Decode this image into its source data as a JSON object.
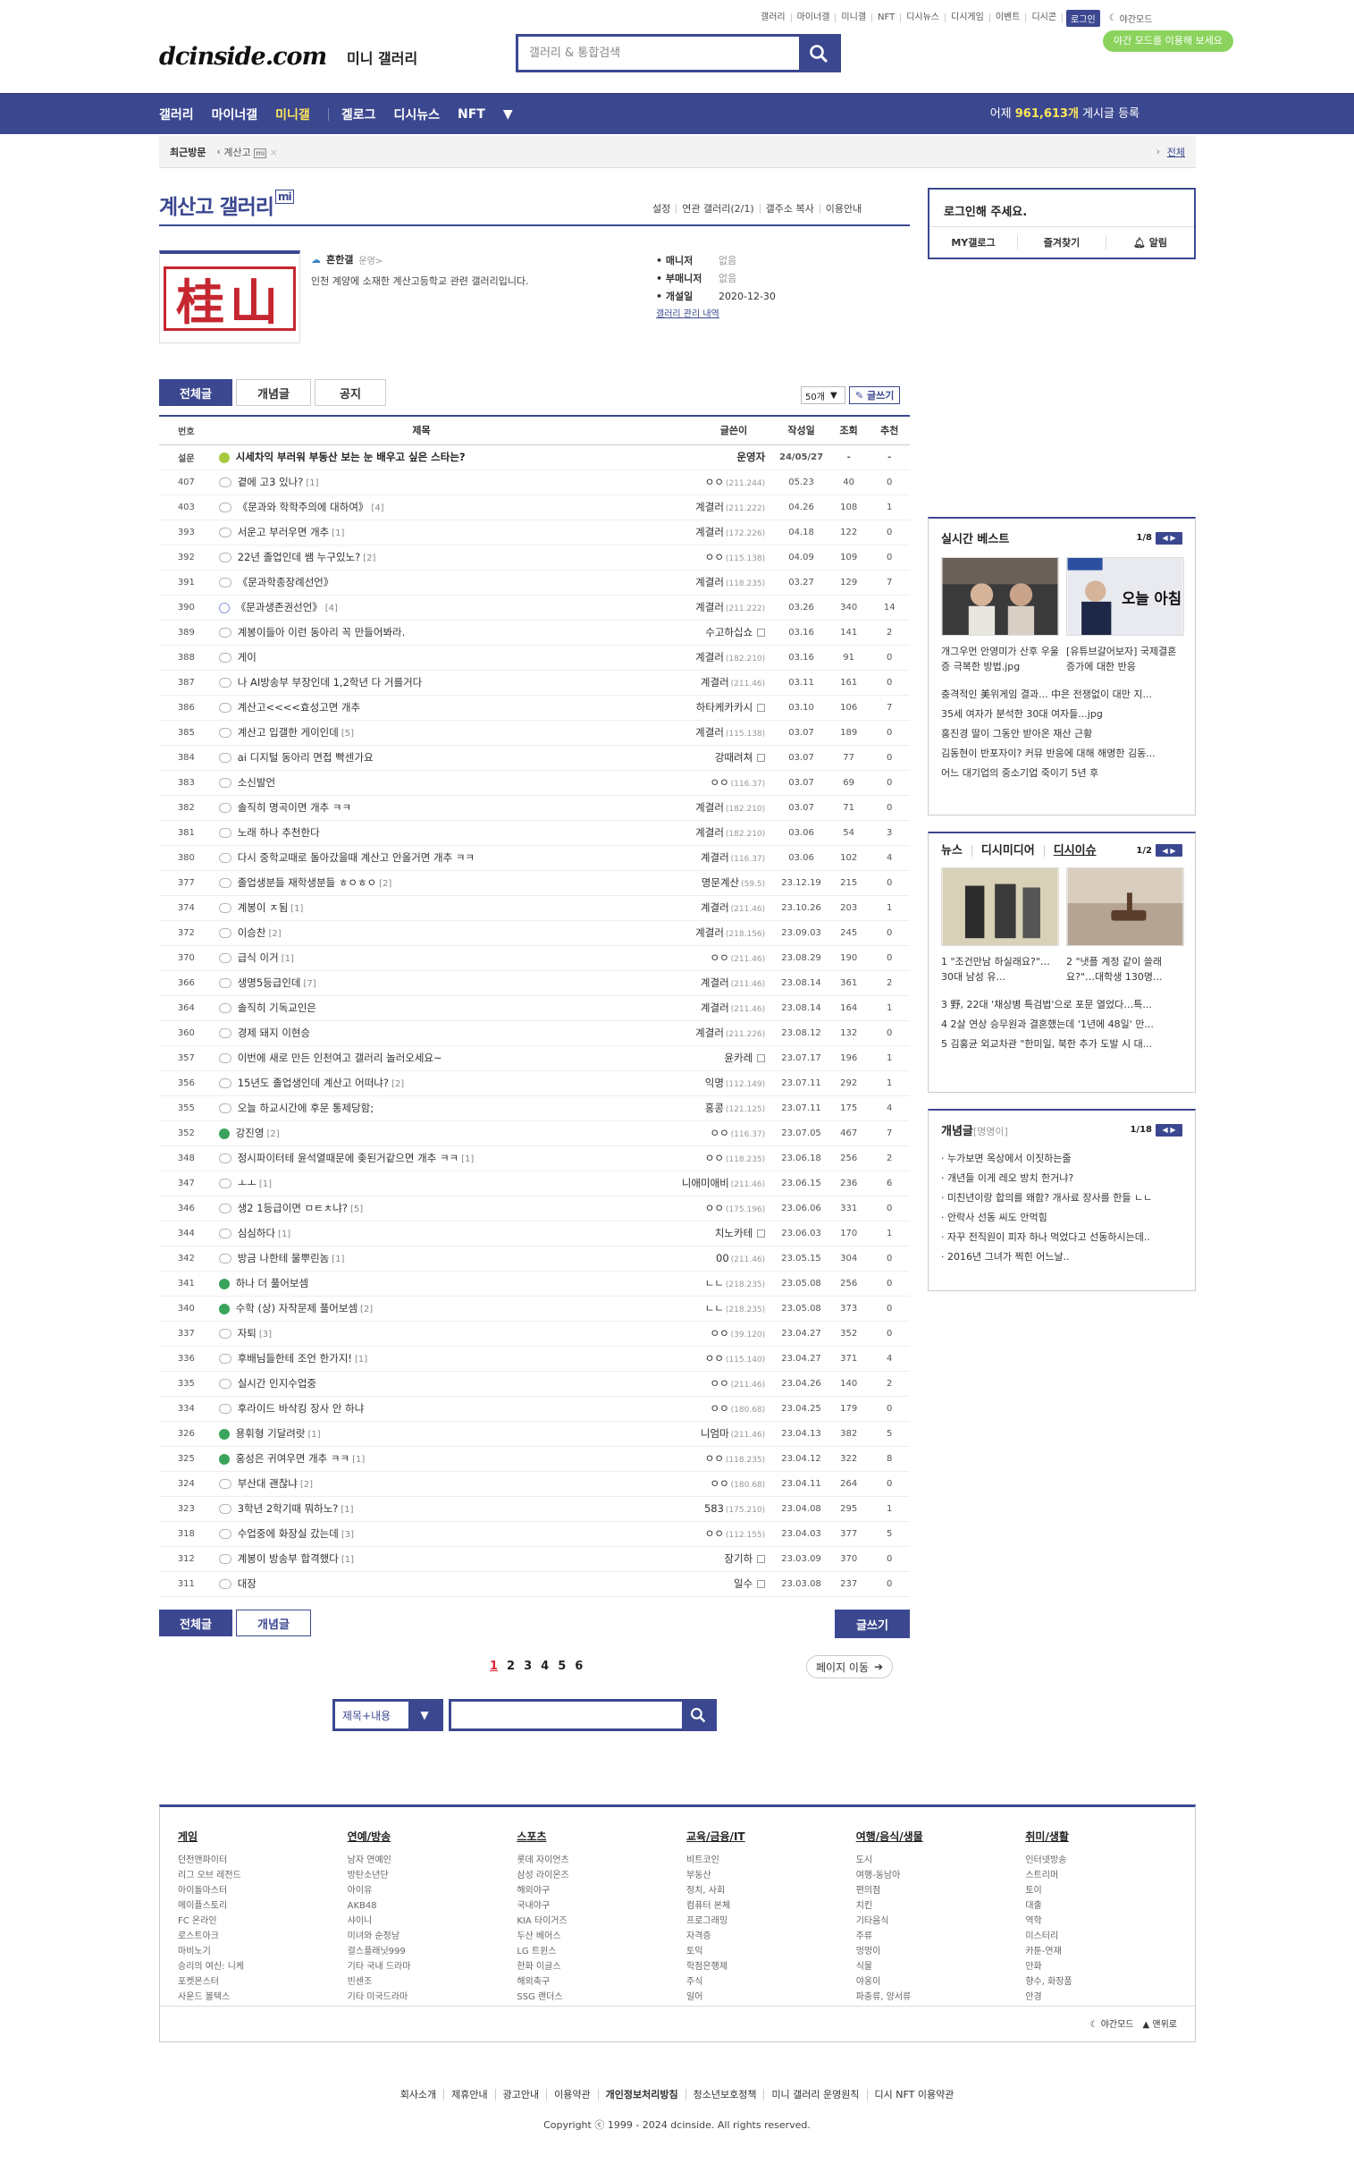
{
  "top": {
    "links": [
      "갤러리",
      "마이너갤",
      "미니갤",
      "NFT",
      "디시뉴스",
      "디시게임",
      "이벤트",
      "디시콘"
    ],
    "login": "로그인",
    "night": "야간모드",
    "night_tip": "야간 모드를 이용해 보세요"
  },
  "logo": {
    "text": "dcinside.com",
    "sub": "미니 갤러리"
  },
  "search": {
    "placeholder": "갤러리 & 통합검색"
  },
  "nav": {
    "items": [
      "갤러리",
      "마이너갤",
      "미니갤",
      "겔로그",
      "디시뉴스",
      "NFT"
    ],
    "count_prefix": "어제",
    "count_value": "961,613개",
    "count_suffix": "게시글 등록"
  },
  "recent": {
    "label": "최근방문",
    "item": "계산고",
    "all": "전체"
  },
  "gallery": {
    "title": "계산고 갤러리",
    "badge": "mi",
    "links": [
      "설정",
      "연관 갤러리(2/1)",
      "갤주소 복사",
      "이용안내"
    ],
    "manager": "흔한갤",
    "manager_sub": "운영>",
    "desc": "인천 계양에 소재한 계산고등학교 관련 갤러리입니다.",
    "image_text": "桂山",
    "meta": [
      {
        "k": "매니저",
        "v": "없음"
      },
      {
        "k": "부매니저",
        "v": "없음"
      },
      {
        "k": "개설일",
        "v": "2020-12-30"
      }
    ],
    "history": "갤러리 관리 내역"
  },
  "tabs": [
    "전체글",
    "개념글",
    "공지"
  ],
  "list_tools": {
    "count": "50개",
    "write": "글쓰기"
  },
  "table": {
    "headers": [
      "번호",
      "제목",
      "글쓴이",
      "작성일",
      "조회",
      "추천"
    ],
    "notice": {
      "num": "설문",
      "title": "시세차익 부러워 부동산 보는 눈 배우고 싶은 스타는?",
      "writer": "운영자",
      "date": "24/05/27",
      "views": "-",
      "rec": "-"
    },
    "rows": [
      {
        "num": "407",
        "title": "곁에 고3 있나?",
        "cmt": "[1]",
        "writer": "ㅇㅇ",
        "ip": "(211.244)",
        "date": "05.23",
        "views": "40",
        "rec": "0",
        "icon": "txt"
      },
      {
        "num": "403",
        "title": "《문과와 학학주의에 대하여》",
        "cmt": "[4]",
        "writer": "계결러",
        "ip": "(211.222)",
        "date": "04.26",
        "views": "108",
        "rec": "1",
        "icon": "txt"
      },
      {
        "num": "393",
        "title": "서운고 부러우면 개추",
        "cmt": "[1]",
        "writer": "계결러",
        "ip": "(172.226)",
        "date": "04.18",
        "views": "122",
        "rec": "0",
        "icon": "txt"
      },
      {
        "num": "392",
        "title": "22년 졸업인데 쌤 누구있노?",
        "cmt": "[2]",
        "writer": "ㅇㅇ",
        "ip": "(115.138)",
        "date": "04.09",
        "views": "109",
        "rec": "0",
        "icon": "txt"
      },
      {
        "num": "391",
        "title": "《문과학종장례선언》",
        "cmt": "",
        "writer": "계결러",
        "ip": "(118.235)",
        "date": "03.27",
        "views": "129",
        "rec": "7",
        "icon": "txt"
      },
      {
        "num": "390",
        "title": "《문과생존권선언》",
        "cmt": "[4]",
        "writer": "계결러",
        "ip": "(211.222)",
        "date": "03.26",
        "views": "340",
        "rec": "14",
        "icon": "img"
      },
      {
        "num": "389",
        "title": "계봉이들아 이런 동아리 꼭 만들어봐라.",
        "cmt": "",
        "writer": "수고하십쇼",
        "ip": "",
        "date": "03.16",
        "views": "141",
        "rec": "2",
        "icon": "txt"
      },
      {
        "num": "388",
        "title": "게이",
        "cmt": "",
        "writer": "계결러",
        "ip": "(182.210)",
        "date": "03.16",
        "views": "91",
        "rec": "0",
        "icon": "txt"
      },
      {
        "num": "387",
        "title": "나 AI방송부 부장인데 1,2학년 다 거를거다",
        "cmt": "",
        "writer": "계결러",
        "ip": "(211.46)",
        "date": "03.11",
        "views": "161",
        "rec": "0",
        "icon": "txt"
      },
      {
        "num": "386",
        "title": "계산고<<<<효성고면 개추",
        "cmt": "",
        "writer": "하타케카카시",
        "ip": "",
        "date": "03.10",
        "views": "106",
        "rec": "7",
        "icon": "txt"
      },
      {
        "num": "385",
        "title": "계산고 입갤한 게이인데",
        "cmt": "[5]",
        "writer": "계결러",
        "ip": "(115.138)",
        "date": "03.07",
        "views": "189",
        "rec": "0",
        "icon": "txt"
      },
      {
        "num": "384",
        "title": "ai 디지털 동아리 면접 빡센가요",
        "cmt": "",
        "writer": "강때려쳐",
        "ip": "",
        "date": "03.07",
        "views": "77",
        "rec": "0",
        "icon": "txt"
      },
      {
        "num": "383",
        "title": "소신발언",
        "cmt": "",
        "writer": "ㅇㅇ",
        "ip": "(116.37)",
        "date": "03.07",
        "views": "69",
        "rec": "0",
        "icon": "txt"
      },
      {
        "num": "382",
        "title": "솔직히 명곡이면 개추 ㅋㅋ",
        "cmt": "",
        "writer": "계결러",
        "ip": "(182.210)",
        "date": "03.07",
        "views": "71",
        "rec": "0",
        "icon": "txt"
      },
      {
        "num": "381",
        "title": "노래 하나 추천한다",
        "cmt": "",
        "writer": "계결러",
        "ip": "(182.210)",
        "date": "03.06",
        "views": "54",
        "rec": "3",
        "icon": "txt"
      },
      {
        "num": "380",
        "title": "다시 중학교때로 돌아갔을때 계산고 안올거면 개추 ㅋㅋ",
        "cmt": "",
        "writer": "계결러",
        "ip": "(116.37)",
        "date": "03.06",
        "views": "102",
        "rec": "4",
        "icon": "txt"
      },
      {
        "num": "377",
        "title": "졸업생분들 재학생분들 ㅎㅇㅎㅇ",
        "cmt": "[2]",
        "writer": "명문계산",
        "ip": "(59.5)",
        "date": "23.12.19",
        "views": "215",
        "rec": "0",
        "icon": "txt"
      },
      {
        "num": "374",
        "title": "계봉이 ㅈ됨",
        "cmt": "[1]",
        "writer": "계결러",
        "ip": "(211.46)",
        "date": "23.10.26",
        "views": "203",
        "rec": "1",
        "icon": "txt"
      },
      {
        "num": "372",
        "title": "이승찬",
        "cmt": "[2]",
        "writer": "계결러",
        "ip": "(218.156)",
        "date": "23.09.03",
        "views": "245",
        "rec": "0",
        "icon": "txt"
      },
      {
        "num": "370",
        "title": "급식 이거",
        "cmt": "[1]",
        "writer": "ㅇㅇ",
        "ip": "(211.46)",
        "date": "23.08.29",
        "views": "190",
        "rec": "0",
        "icon": "txt"
      },
      {
        "num": "366",
        "title": "생명5등급인데",
        "cmt": "[7]",
        "writer": "계결러",
        "ip": "(211.46)",
        "date": "23.08.14",
        "views": "361",
        "rec": "2",
        "icon": "txt"
      },
      {
        "num": "364",
        "title": "솔직히 기독교인은",
        "cmt": "",
        "writer": "계결러",
        "ip": "(211.46)",
        "date": "23.08.14",
        "views": "164",
        "rec": "1",
        "icon": "txt"
      },
      {
        "num": "360",
        "title": "경제 돼지 이현승",
        "cmt": "",
        "writer": "계결러",
        "ip": "(211.226)",
        "date": "23.08.12",
        "views": "132",
        "rec": "0",
        "icon": "txt"
      },
      {
        "num": "357",
        "title": "이번에 새로 만든 인천여고 갤러리 놀러오세요~",
        "cmt": "",
        "writer": "윤카레",
        "ip": "",
        "date": "23.07.17",
        "views": "196",
        "rec": "1",
        "icon": "txt"
      },
      {
        "num": "356",
        "title": "15년도 졸업생인데 계산고 어떠냐?",
        "cmt": "[2]",
        "writer": "익명",
        "ip": "(112.149)",
        "date": "23.07.11",
        "views": "292",
        "rec": "1",
        "icon": "txt"
      },
      {
        "num": "355",
        "title": "오늘 하교시간에 후문 통제당함;",
        "cmt": "",
        "writer": "홍콩",
        "ip": "(121.125)",
        "date": "23.07.11",
        "views": "175",
        "rec": "4",
        "icon": "txt"
      },
      {
        "num": "352",
        "title": "강진영",
        "cmt": "[2]",
        "writer": "ㅇㅇ",
        "ip": "(116.37)",
        "date": "23.07.05",
        "views": "467",
        "rec": "7",
        "icon": "green"
      },
      {
        "num": "348",
        "title": "정시파이터테 윤석열때문에 좆된거같으면 개추 ㅋㅋ",
        "cmt": "[1]",
        "writer": "ㅇㅇ",
        "ip": "(118.235)",
        "date": "23.06.18",
        "views": "256",
        "rec": "2",
        "icon": "txt"
      },
      {
        "num": "347",
        "title": "ㅗㅗ",
        "cmt": "[1]",
        "writer": "니애미애비",
        "ip": "(211.46)",
        "date": "23.06.15",
        "views": "236",
        "rec": "6",
        "icon": "txt"
      },
      {
        "num": "346",
        "title": "생2 1등급이면 ㅁㅌㅊ냐?",
        "cmt": "[5]",
        "writer": "ㅇㅇ",
        "ip": "(175.196)",
        "date": "23.06.06",
        "views": "331",
        "rec": "0",
        "icon": "txt"
      },
      {
        "num": "344",
        "title": "심심하다",
        "cmt": "[1]",
        "writer": "치노카테",
        "ip": "",
        "date": "23.06.03",
        "views": "170",
        "rec": "1",
        "icon": "txt"
      },
      {
        "num": "342",
        "title": "방금 나한테 물뿌린놈",
        "cmt": "[1]",
        "writer": "00",
        "ip": "(211.46)",
        "date": "23.05.15",
        "views": "304",
        "rec": "0",
        "icon": "txt"
      },
      {
        "num": "341",
        "title": "하나 더 풀어보셈",
        "cmt": "",
        "writer": "ㄴㄴ",
        "ip": "(218.235)",
        "date": "23.05.08",
        "views": "256",
        "rec": "0",
        "icon": "green"
      },
      {
        "num": "340",
        "title": "수학 (상) 자작문제 풀어보셈",
        "cmt": "[2]",
        "writer": "ㄴㄴ",
        "ip": "(218.235)",
        "date": "23.05.08",
        "views": "373",
        "rec": "0",
        "icon": "green"
      },
      {
        "num": "337",
        "title": "자퇴",
        "cmt": "[3]",
        "writer": "ㅇㅇ",
        "ip": "(39.120)",
        "date": "23.04.27",
        "views": "352",
        "rec": "0",
        "icon": "txt"
      },
      {
        "num": "336",
        "title": "후배님들한테 조언 한가지!",
        "cmt": "[1]",
        "writer": "ㅇㅇ",
        "ip": "(115.140)",
        "date": "23.04.27",
        "views": "371",
        "rec": "4",
        "icon": "txt"
      },
      {
        "num": "335",
        "title": "실시간 인지수업중",
        "cmt": "",
        "writer": "ㅇㅇ",
        "ip": "(211.46)",
        "date": "23.04.26",
        "views": "140",
        "rec": "2",
        "icon": "txt"
      },
      {
        "num": "334",
        "title": "후라이드 바삭킹 장사 안 하냐",
        "cmt": "",
        "writer": "ㅇㅇ",
        "ip": "(180.68)",
        "date": "23.04.25",
        "views": "179",
        "rec": "0",
        "icon": "txt"
      },
      {
        "num": "326",
        "title": "용휘형 기달려랏",
        "cmt": "[1]",
        "writer": "니엄마",
        "ip": "(211.46)",
        "date": "23.04.13",
        "views": "382",
        "rec": "5",
        "icon": "green"
      },
      {
        "num": "325",
        "title": "홍성은 귀여우면 개추 ㅋㅋ",
        "cmt": "[1]",
        "writer": "ㅇㅇ",
        "ip": "(118.235)",
        "date": "23.04.12",
        "views": "322",
        "rec": "8",
        "icon": "green"
      },
      {
        "num": "324",
        "title": "부산대 괜찮냐",
        "cmt": "[2]",
        "writer": "ㅇㅇ",
        "ip": "(180.68)",
        "date": "23.04.11",
        "views": "264",
        "rec": "0",
        "icon": "txt"
      },
      {
        "num": "323",
        "title": "3학년 2학기때 뭐하노?",
        "cmt": "[1]",
        "writer": "583",
        "ip": "(175.210)",
        "date": "23.04.08",
        "views": "295",
        "rec": "1",
        "icon": "txt"
      },
      {
        "num": "318",
        "title": "수업중에 화장실 갔는데",
        "cmt": "[3]",
        "writer": "ㅇㅇ",
        "ip": "(112.155)",
        "date": "23.04.03",
        "views": "377",
        "rec": "5",
        "icon": "txt"
      },
      {
        "num": "312",
        "title": "계봉이 방송부 합격했다",
        "cmt": "[1]",
        "writer": "장기하",
        "ip": "",
        "date": "23.03.09",
        "views": "370",
        "rec": "0",
        "icon": "txt"
      },
      {
        "num": "311",
        "title": "대장",
        "cmt": "",
        "writer": "일수",
        "ip": "",
        "date": "23.03.08",
        "views": "237",
        "rec": "0",
        "icon": "txt"
      }
    ]
  },
  "bottom": {
    "tabs": [
      "전체글",
      "개념글"
    ],
    "write": "글쓰기",
    "pages": [
      "1",
      "2",
      "3",
      "4",
      "5",
      "6"
    ],
    "page_move": "페이지 이동",
    "search_select": "제목+내용"
  },
  "sidebar": {
    "login_title": "로그인해 주세요.",
    "login_btns": [
      "MY갤로그",
      "즐겨찾기",
      "알림"
    ],
    "best": {
      "title": "실시간 베스트",
      "page": "1/8",
      "thumbs": [
        "개그우먼 안영미가 산후 우울증 극복한 방법.jpg",
        "[유튜브갈어보자] 국제결혼 증가에 대한 반응"
      ],
      "list": [
        "충격적인 美위게임 결과... 中은 전쟁없이 대만 지...",
        "35세 여자가 분석한 30대 여자들...jpg",
        "홍진경 딸이 그동안 받아온 재산 근황",
        "김동현이 반포자이? 커뮤 반응에 대해 해명한 김동...",
        "어느 대기업의 중소기업 죽이기 5년 후"
      ]
    },
    "news": {
      "tabs": [
        "뉴스",
        "디시미디어",
        "디시이슈"
      ],
      "page": "1/2",
      "thumbs": [
        "1 \"조건만남 하실래요?\"…30대 남성 유...",
        "2 \"냇플 계정 같이 쓸래요?\"…대학생 130명..."
      ],
      "list": [
        "3 野, 22대 '채상병 특검법'으로 포문 열었다…특...",
        "4 2살 연상 승무원과 결혼했는데 '1년에 48일' 만...",
        "5 김홍균 외교차관 \"한미일, 북한 추가 도발 시 대..."
      ]
    },
    "concept": {
      "title": "개념글",
      "sub": "[명명이]",
      "page": "1/18",
      "list": [
        "누가보면 옥상에서 이짓하는줄",
        "개년들 이게 레오 방치 한거냐?",
        "미친년이랑 합의를 왜함? 개사료 장사를 한들 ㄴㄴ",
        "안락사 선동 씨도 안먹힘",
        "자꾸 전직원이 피자 하나 먹었다고 선동하시는데..",
        "2016년 그녀가 찍힌 어느날.."
      ]
    }
  },
  "footer": {
    "cols": [
      {
        "h": "게임",
        "items": [
          "던전앤파이터",
          "리그 오브 레전드",
          "아이돌마스터",
          "메이플스토리",
          "FC 온라인",
          "로스트아크",
          "마비노기",
          "승리의 여신: 니케",
          "포켓몬스터",
          "사운드 볼텍스"
        ]
      },
      {
        "h": "연예/방송",
        "items": [
          "남자 연예인",
          "방탄소년단",
          "아이유",
          "AKB48",
          "샤이니",
          "미녀와 순정남",
          "걸스플래닛999",
          "기타 국내 드라마",
          "빈센조",
          "기타 미국드라마"
        ]
      },
      {
        "h": "스포츠",
        "items": [
          "롯데 자이언츠",
          "삼성 라이온즈",
          "해외야구",
          "국내야구",
          "KIA 타이거즈",
          "두산 베어스",
          "LG 트윈스",
          "한화 이글스",
          "해외축구",
          "SSG 랜더스"
        ]
      },
      {
        "h": "교육/금융/IT",
        "items": [
          "비트코인",
          "부동산",
          "정치, 사회",
          "컴퓨터 본체",
          "프로그래밍",
          "자격증",
          "토익",
          "학점은행제",
          "주식",
          "일어"
        ]
      },
      {
        "h": "여행/음식/생물",
        "items": [
          "도시",
          "여행-동남아",
          "편의점",
          "치킨",
          "기타음식",
          "주류",
          "멍멍이",
          "식물",
          "야옹이",
          "파충류, 양서류"
        ]
      },
      {
        "h": "취미/생활",
        "items": [
          "인터넷방송",
          "스트리머",
          "토이",
          "대출",
          "역학",
          "미스터리",
          "카툰-연재",
          "만화",
          "향수, 화장품",
          "안경"
        ]
      }
    ],
    "night": "야간모드",
    "top": "맨위로",
    "links": [
      "회사소개",
      "제휴안내",
      "광고안내",
      "이용약관",
      "개인정보처리방침",
      "청소년보호정책",
      "미니 갤러리 운영원칙",
      "디시 NFT 이용약관"
    ],
    "copyright": "Copyright ⓒ 1999 - 2024 dcinside. All rights reserved."
  },
  "colors": {
    "brand": "#3b4890",
    "accent": "#ffe75a",
    "night_tip": "#8bd35d"
  }
}
